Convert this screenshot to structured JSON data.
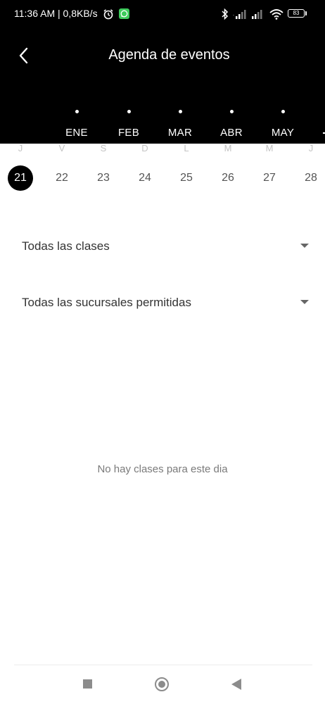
{
  "status_bar": {
    "time": "11:36 AM",
    "network_speed": "0,8KB/s",
    "battery_level": "83",
    "icons": [
      "alarm-icon",
      "whatsapp-icon",
      "bluetooth-icon",
      "signal-icon",
      "signal-icon",
      "wifi-icon",
      "battery-icon"
    ]
  },
  "header": {
    "title": "Agenda de eventos",
    "back_icon": "chevron-left-icon"
  },
  "months": [
    {
      "label": "ENE"
    },
    {
      "label": "FEB"
    },
    {
      "label": "MAR"
    },
    {
      "label": "ABR"
    },
    {
      "label": "MAY"
    }
  ],
  "days": [
    {
      "weekday": "J",
      "day": "21",
      "selected": true
    },
    {
      "weekday": "V",
      "day": "22",
      "selected": false
    },
    {
      "weekday": "S",
      "day": "23",
      "selected": false
    },
    {
      "weekday": "D",
      "day": "24",
      "selected": false
    },
    {
      "weekday": "L",
      "day": "25",
      "selected": false
    },
    {
      "weekday": "M",
      "day": "26",
      "selected": false
    },
    {
      "weekday": "M",
      "day": "27",
      "selected": false
    },
    {
      "weekday": "J",
      "day": "28",
      "selected": false
    }
  ],
  "filters": {
    "classes": {
      "label": "Todas las clases",
      "icon": "caret-down-icon"
    },
    "branches": {
      "label": "Todas las sucursales permitidas",
      "icon": "caret-down-icon"
    }
  },
  "empty_message": "No hay clases para este dia",
  "colors": {
    "header_bg": "#000000",
    "selected_day_bg": "#000000",
    "page_bg": "#ffffff"
  },
  "nav_bar": {
    "icons": [
      "recents-square-icon",
      "home-circle-icon",
      "back-triangle-icon"
    ]
  }
}
